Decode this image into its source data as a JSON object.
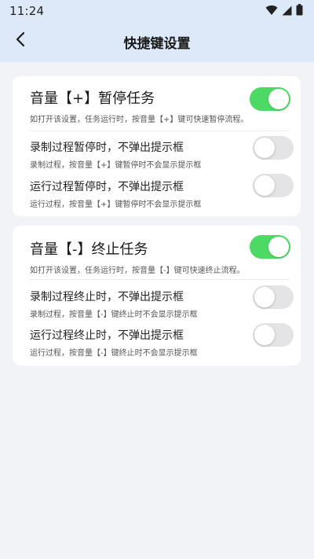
{
  "status_bar": {
    "time": "11:24",
    "icons": [
      "wifi-icon",
      "signal-icon",
      "battery-icon"
    ]
  },
  "header": {
    "title": "快捷键设置",
    "back_icon": "chevron-left-icon"
  },
  "colors": {
    "toggle_on": "#4cd964",
    "toggle_off": "#e4e4e6",
    "header_bg": "#dde9f9",
    "page_bg": "#f2f3f7"
  },
  "pause_card": {
    "main": {
      "title": "音量【+】暂停任务",
      "desc": "如打开该设置，任务运行时，按音量【+】键可快速暂停流程。",
      "enabled": true
    },
    "options": [
      {
        "title": "录制过程暂停时，不弹出提示框",
        "desc": "录制过程，按音量【+】键暂停时不会显示提示框",
        "enabled": false
      },
      {
        "title": "运行过程暂停时，不弹出提示框",
        "desc": "运行过程，按音量【+】键暂停时不会显示提示框",
        "enabled": false
      }
    ]
  },
  "stop_card": {
    "main": {
      "title": "音量【-】终止任务",
      "desc": "如打开该设置，任务运行时，按音量【-】键可快速终止流程。",
      "enabled": true
    },
    "options": [
      {
        "title": "录制过程终止时，不弹出提示框",
        "desc": "录制过程，按音量【-】键终止时不会显示提示框",
        "enabled": false
      },
      {
        "title": "运行过程终止时，不弹出提示框",
        "desc": "运行过程，按音量【-】键终止时不会显示提示框",
        "enabled": false
      }
    ]
  }
}
